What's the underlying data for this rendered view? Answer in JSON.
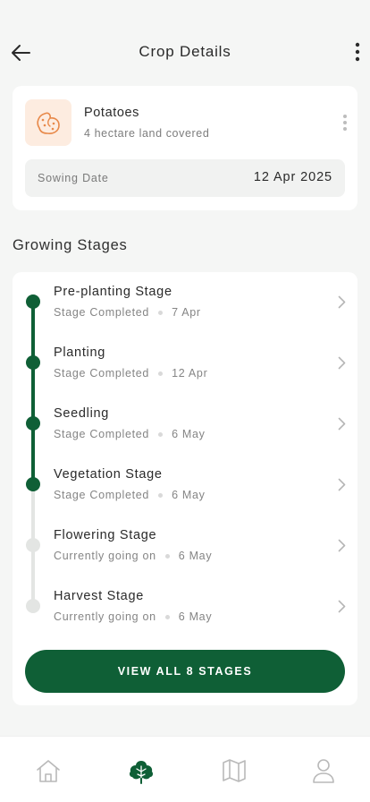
{
  "header": {
    "title": "Crop Details",
    "back_icon": "arrow-left-icon",
    "more_icon": "vertical-dots-icon"
  },
  "crop": {
    "icon": "potato-icon",
    "name": "Potatoes",
    "subtitle": "4 hectare land covered",
    "sowing_label": "Sowing Date",
    "sowing_date": "12 Apr 2025"
  },
  "growing_stages": {
    "title": "Growing Stages",
    "stages": [
      {
        "name": "Pre-planting Stage",
        "status": "Stage Completed",
        "date": "7 Apr",
        "completed": true
      },
      {
        "name": "Planting",
        "status": "Stage Completed",
        "date": "12 Apr",
        "completed": true
      },
      {
        "name": "Seedling",
        "status": "Stage Completed",
        "date": "6 May",
        "completed": true
      },
      {
        "name": "Vegetation Stage",
        "status": "Stage Completed",
        "date": "6 May",
        "completed": true
      },
      {
        "name": "Flowering Stage",
        "status": "Currently going on",
        "date": "6 May",
        "completed": false
      },
      {
        "name": "Harvest Stage",
        "status": "Currently going on",
        "date": "6 May",
        "completed": false
      }
    ],
    "view_all_label": "VIEW ALL 8 STAGES"
  },
  "bottom_nav": {
    "items": [
      {
        "icon": "home-icon",
        "active": false
      },
      {
        "icon": "crop-icon",
        "active": true
      },
      {
        "icon": "map-icon",
        "active": false
      },
      {
        "icon": "profile-icon",
        "active": false
      }
    ]
  },
  "colors": {
    "accent": "#0f5f36",
    "pending": "#e3e5e3",
    "crop_icon_bg": "#fdece0",
    "crop_icon_stroke": "#e8894a"
  }
}
